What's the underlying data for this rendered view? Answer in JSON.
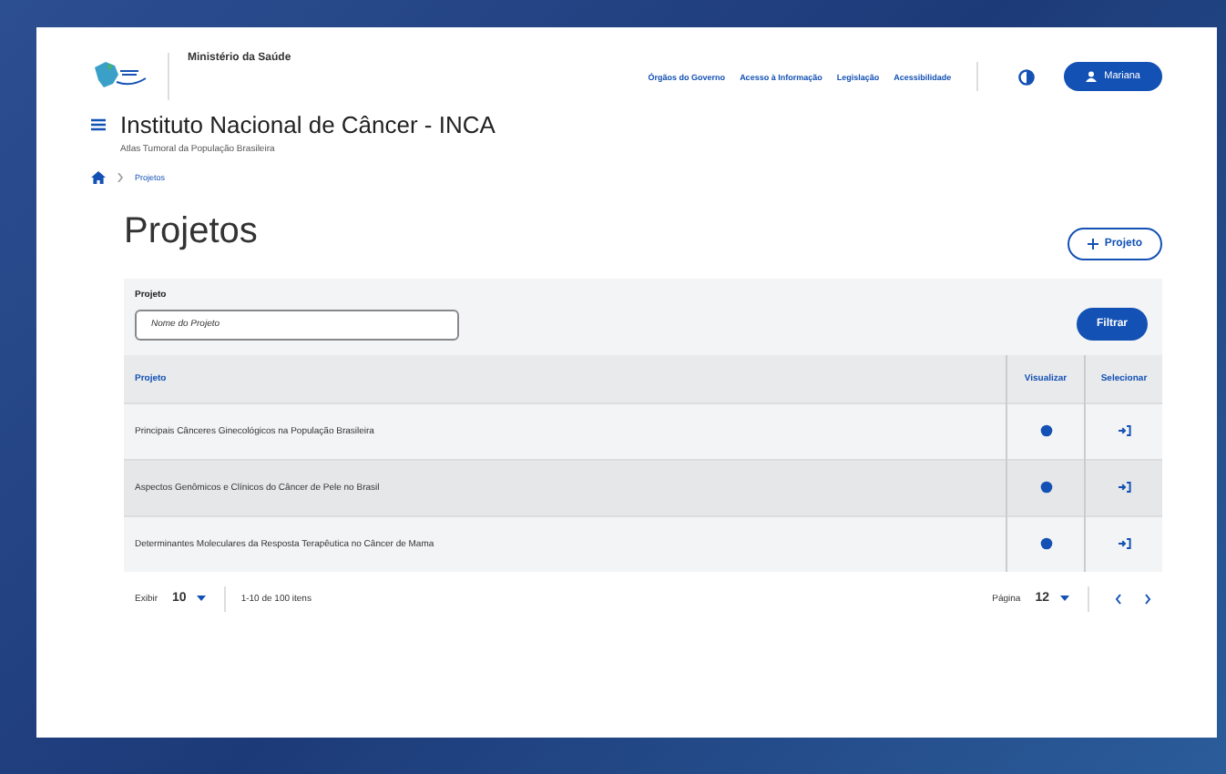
{
  "header": {
    "ministry": "Ministério da Saúde",
    "links": [
      "Órgãos do Governo",
      "Acesso à Informação",
      "Legislação",
      "Acessibilidade"
    ],
    "user": "Mariana"
  },
  "site": {
    "title": "Instituto Nacional de Câncer - INCA",
    "subtitle": "Atlas Tumoral da População Brasileira"
  },
  "breadcrumb": [
    "Projetos"
  ],
  "page_title": "Projetos",
  "new_button": "Projeto",
  "filter": {
    "label": "Projeto",
    "placeholder": "Nome do Projeto",
    "button": "Filtrar"
  },
  "table": {
    "columns": [
      "Projeto",
      "Visualizar",
      "Selecionar"
    ],
    "rows": [
      {
        "name": "Principais Cânceres Ginecológicos na População Brasileira"
      },
      {
        "name": "Aspectos Genômicos e Clínicos do Câncer de Pele no Brasil"
      },
      {
        "name": "Determinantes Moleculares da Resposta Terapêutica no Câncer de Mama"
      }
    ]
  },
  "pagination": {
    "show_label": "Exibir",
    "per_page": "10",
    "range": "1-10 de 100 itens",
    "page_label": "Página",
    "page": "12"
  }
}
